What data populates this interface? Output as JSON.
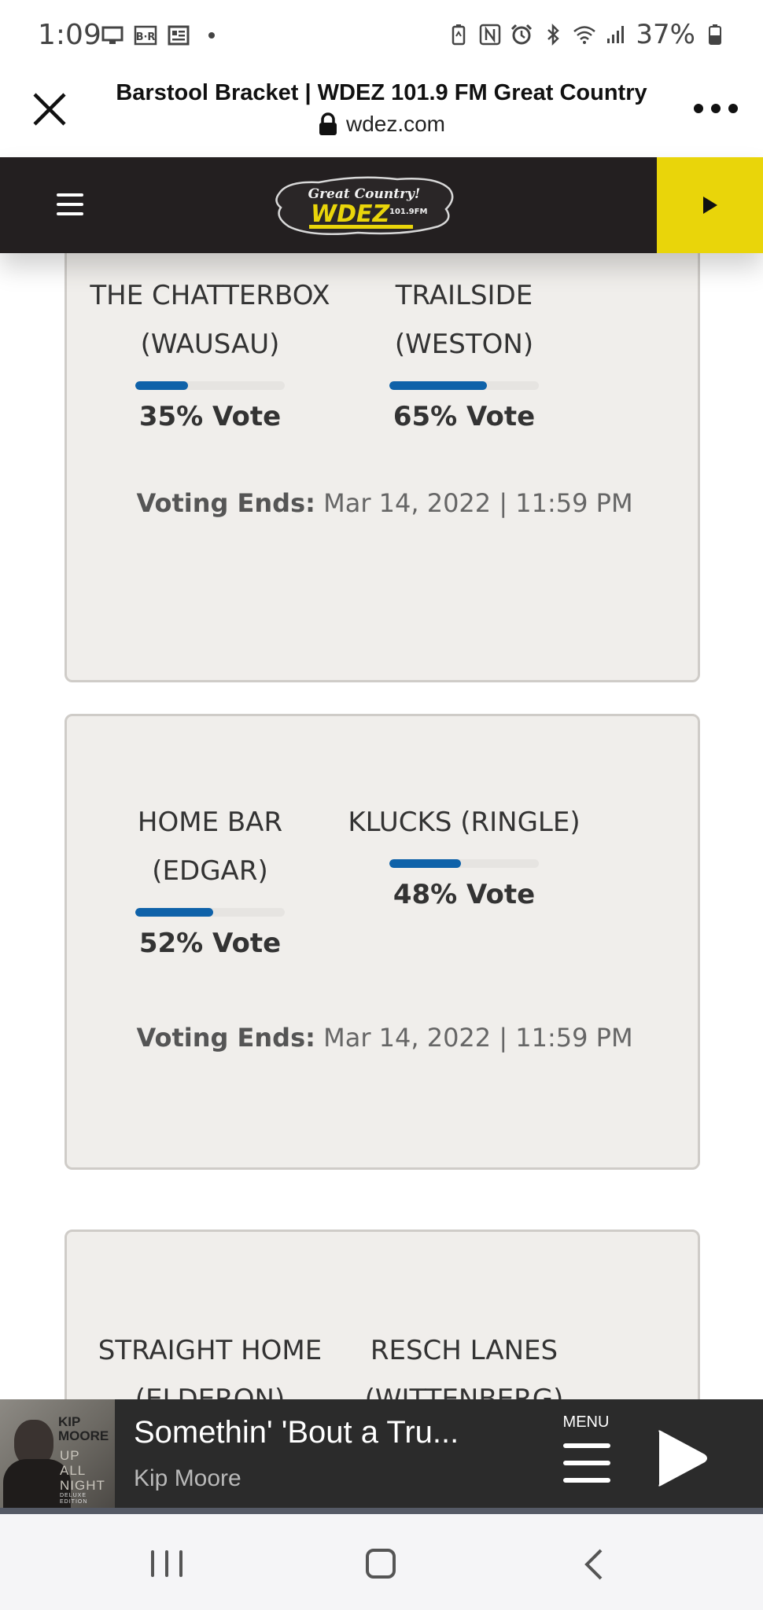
{
  "status_bar": {
    "time": "1:09",
    "battery": "37%",
    "left_icons": [
      "monitor-icon",
      "br-icon",
      "news-icon",
      "dot-icon"
    ],
    "right_icons": [
      "battery-saver-icon",
      "nfc-icon",
      "alarm-icon",
      "bluetooth-icon",
      "wifi-icon",
      "signal-icon",
      "battery-icon"
    ]
  },
  "browser": {
    "title": "Barstool Bracket | WDEZ 101.9 FM Great Country",
    "url": "wdez.com"
  },
  "site_header": {
    "logo_line1": "Great Country!",
    "logo_brand": "WDEZ",
    "logo_freq": "101.9FM",
    "accent_color": "#e9d50a"
  },
  "matchups": [
    {
      "teams": [
        {
          "name_line1": "THE CHATTERBOX",
          "name_line2": "(WAUSAU)",
          "percent": 35,
          "vote_label": "35% Vote"
        },
        {
          "name_line1": "TRAILSIDE",
          "name_line2": "(WESTON)",
          "percent": 65,
          "vote_label": "65% Vote"
        }
      ],
      "voting_ends_label": "Voting Ends:",
      "voting_ends_value": " Mar 14, 2022 | 11:59 PM"
    },
    {
      "teams": [
        {
          "name_line1": "HOME BAR",
          "name_line2": "(EDGAR)",
          "percent": 52,
          "vote_label": "52% Vote"
        },
        {
          "name_line1": "KLUCKS (RINGLE)",
          "name_line2": "",
          "percent": 48,
          "vote_label": "48% Vote"
        }
      ],
      "voting_ends_label": "Voting Ends:",
      "voting_ends_value": " Mar 14, 2022 | 11:59 PM"
    },
    {
      "teams": [
        {
          "name_line1": "STRAIGHT HOME",
          "name_line2": "(ELDERON)"
        },
        {
          "name_line1": "RESCH LANES",
          "name_line2": "(WITTENBERG)"
        }
      ]
    }
  ],
  "now_playing": {
    "title": "Somethin' 'Bout a Tru...",
    "artist": "Kip Moore",
    "menu_label": "MENU",
    "album_text_1": "KIP",
    "album_text_2": "MOORE",
    "album_text_3": "UP",
    "album_text_4": "ALL",
    "album_text_5": "NIGHT",
    "album_text_6": "DELUXE EDITION"
  },
  "colors": {
    "vote_bar": "#0f62a9",
    "card_background": "#f0eeeb",
    "header_background": "#231f20"
  }
}
